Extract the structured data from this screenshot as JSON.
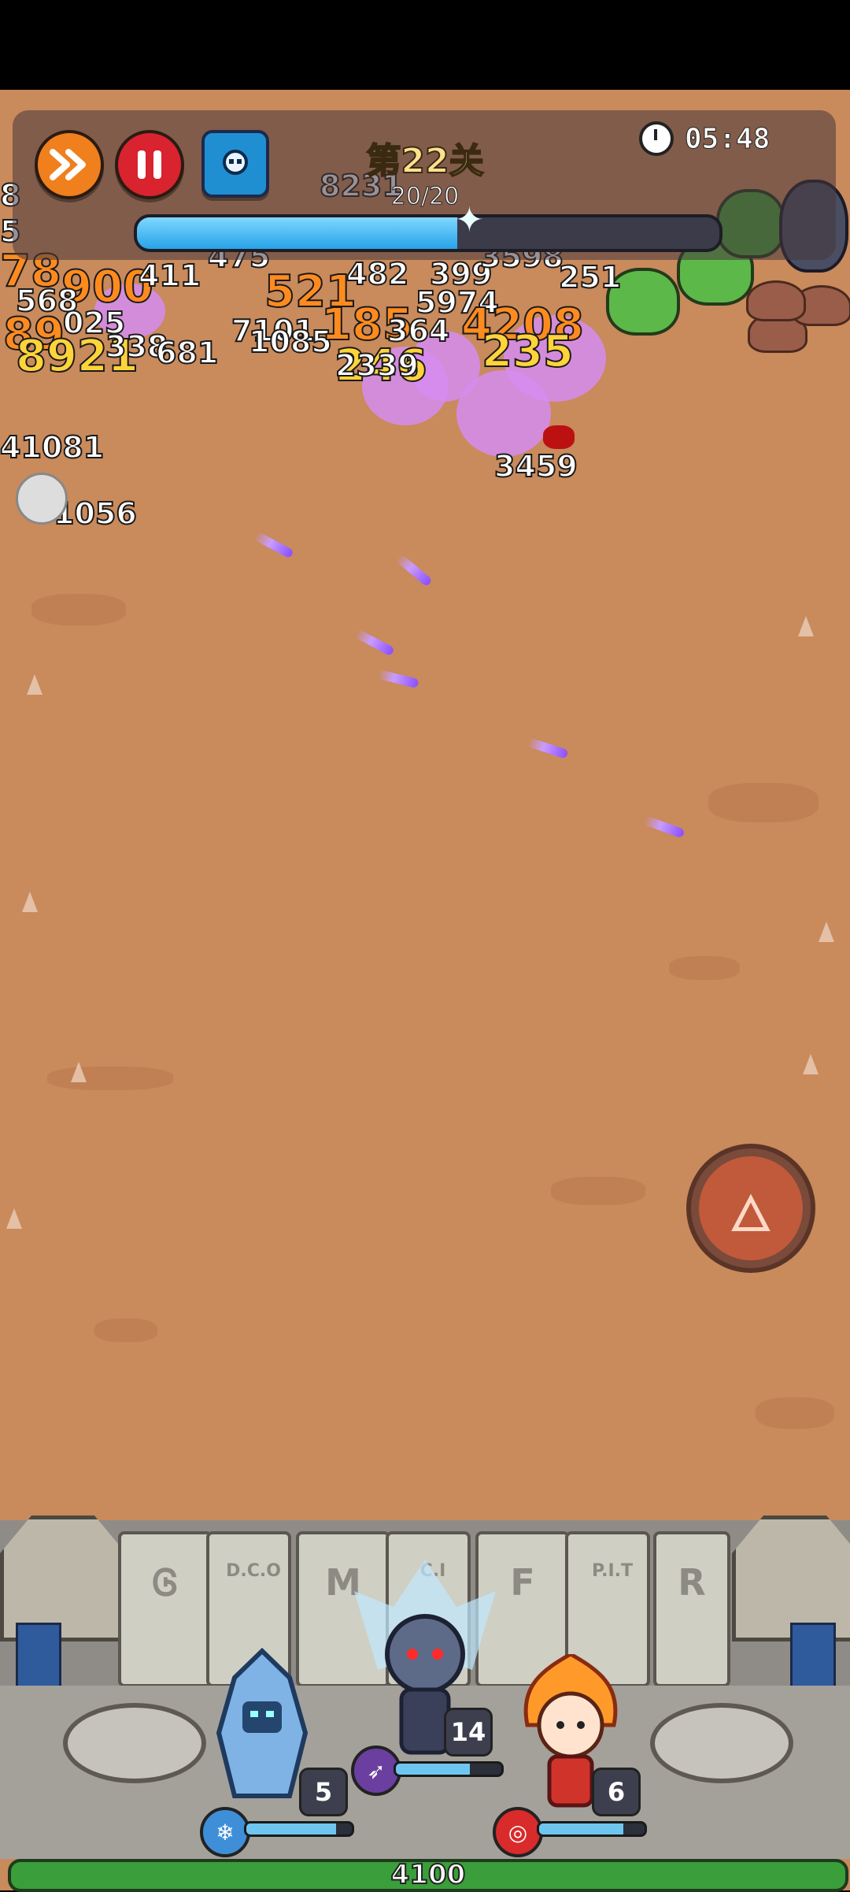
{
  "hud": {
    "level_title": "第22关",
    "wave": "20/20",
    "wave_progress": 0.55,
    "timer": "05:48",
    "buttons": {
      "fast_forward_icon": "fast-forward-icon",
      "pause_icon": "pause-icon",
      "skill_icon": "skill-card-icon"
    }
  },
  "damage_numbers": [
    {
      "text": "8",
      "style": "w"
    },
    {
      "text": "5",
      "style": "w"
    },
    {
      "text": "78",
      "style": "o"
    },
    {
      "text": "900",
      "style": "o"
    },
    {
      "text": "411",
      "style": "w"
    },
    {
      "text": "521",
      "style": "o"
    },
    {
      "text": "482",
      "style": "w"
    },
    {
      "text": "399",
      "style": "w"
    },
    {
      "text": "251",
      "style": "w"
    },
    {
      "text": "568",
      "style": "w"
    },
    {
      "text": "89",
      "style": "o"
    },
    {
      "text": "025",
      "style": "w"
    },
    {
      "text": "8921",
      "style": "y"
    },
    {
      "text": "338",
      "style": "w"
    },
    {
      "text": "681",
      "style": "w"
    },
    {
      "text": "7101",
      "style": "w"
    },
    {
      "text": "1085",
      "style": "w"
    },
    {
      "text": "185",
      "style": "o"
    },
    {
      "text": "364",
      "style": "w"
    },
    {
      "text": "5974",
      "style": "w"
    },
    {
      "text": "4208",
      "style": "o"
    },
    {
      "text": "246",
      "style": "y"
    },
    {
      "text": "2339",
      "style": "w"
    },
    {
      "text": "235",
      "style": "y"
    },
    {
      "text": "41081",
      "style": "w"
    },
    {
      "text": "1056",
      "style": "w"
    },
    {
      "text": "3459",
      "style": "w"
    },
    {
      "text": "8231",
      "style": "w"
    },
    {
      "text": "475",
      "style": "w"
    },
    {
      "text": "3598",
      "style": "w"
    }
  ],
  "skill_button": {
    "icon": "phoenix-icon"
  },
  "wall_runes": [
    "Ꮆ",
    "D.C.O",
    "M",
    "C.I",
    "F",
    "P.I.T",
    "R"
  ],
  "heroes": [
    {
      "name": "ice-knight",
      "level": "5",
      "bar": 0.85,
      "icon": "ice-crystal-icon",
      "icon_color": "#3f8fd8"
    },
    {
      "name": "dark-elf",
      "level": "14",
      "bar": 0.7,
      "icon": "arrow-icon",
      "icon_color": "#6a3fa0"
    },
    {
      "name": "fire-monk",
      "level": "6",
      "bar": 0.8,
      "icon": "target-icon",
      "icon_color": "#d92b2b"
    }
  ],
  "base_hp": "4100"
}
